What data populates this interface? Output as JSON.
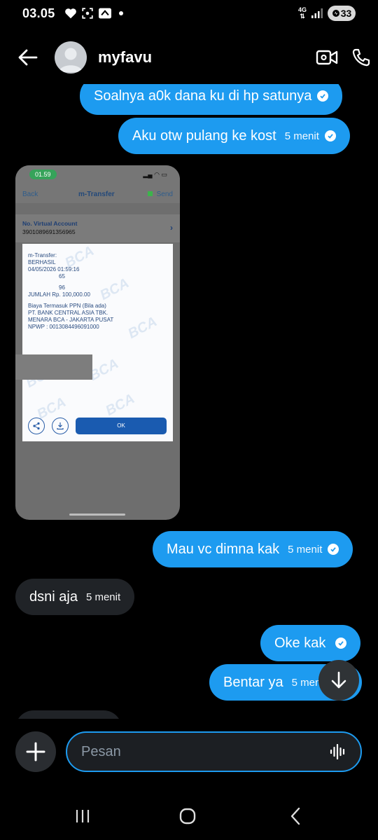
{
  "status_bar": {
    "time": "03.05",
    "network": "4G",
    "battery": "33"
  },
  "header": {
    "contact_name": "myfavu"
  },
  "messages": [
    {
      "direction": "out",
      "text": "Soalnya a0k dana ku di hp satunya",
      "time": ""
    },
    {
      "direction": "out",
      "text": "Aku otw pulang ke kost",
      "time": "5 menit"
    },
    {
      "direction": "out",
      "text": "Mau vc dimna kak",
      "time": "5 menit"
    },
    {
      "direction": "in",
      "text": "dsni aja",
      "time": "5 menit"
    },
    {
      "direction": "out",
      "text": "Oke kak",
      "time": ""
    },
    {
      "direction": "out",
      "text": "Bentar ya",
      "time": "5 menit"
    }
  ],
  "attachment": {
    "status_time": "01.59",
    "back_label": "Back",
    "title": "m-Transfer",
    "send_label": "Send",
    "va_label": "No. Virtual Account",
    "va_number": "3901089691356965",
    "receipt_lines": [
      "m-Transfer:",
      "BERHASIL",
      "04/05/2026 01:59:16",
      "65",
      "96",
      "JUMLAH Rp. 100,000.00",
      "Biaya Termasuk PPN (Bila ada)",
      "PT. BANK CENTRAL ASIA TBK.",
      "MENARA BCA - JAKARTA PUSAT",
      "NPWP : 0013084496091000"
    ],
    "watermark": "BCA",
    "ok_label": "OK"
  },
  "composer": {
    "placeholder": "Pesan"
  }
}
